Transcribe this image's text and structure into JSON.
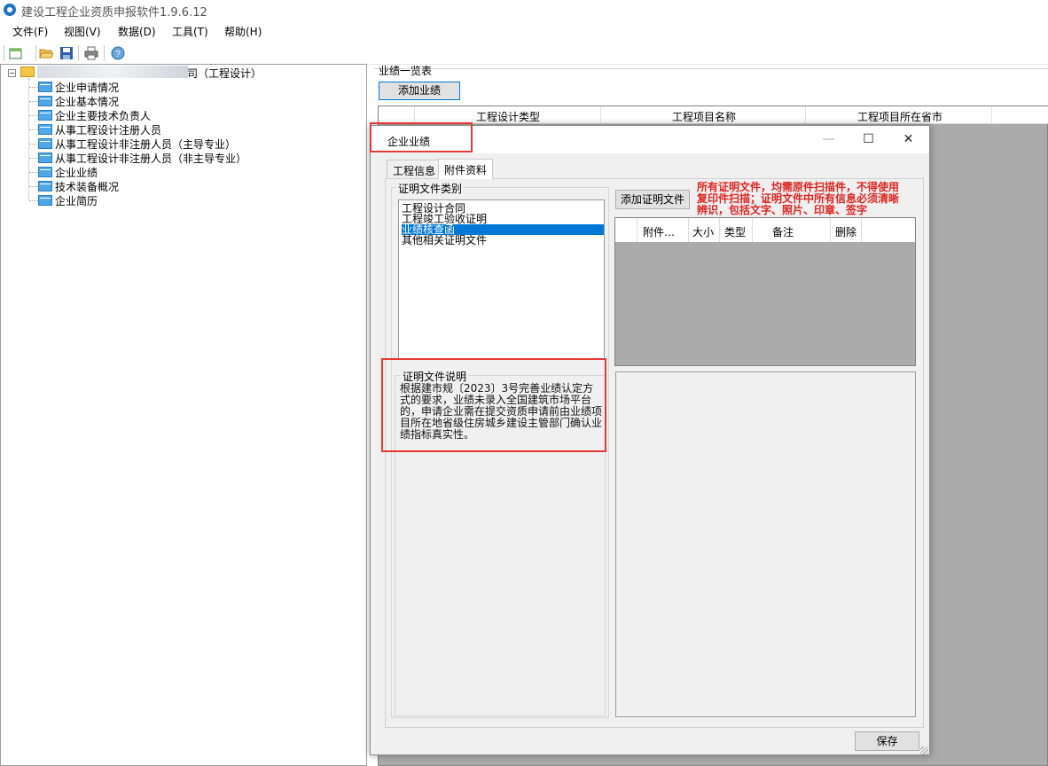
{
  "app": {
    "title": "建设工程企业资质申报软件1.9.6.12"
  },
  "menu": [
    "文件(F)",
    "视图(V)",
    "数据(D)",
    "工具(T)",
    "帮助(H)"
  ],
  "toolbar": {
    "icons": [
      "new-icon",
      "open-folder-icon",
      "save-icon",
      "print-icon",
      "help-icon"
    ]
  },
  "tree": {
    "root_label": "司（工程设计）",
    "items": [
      "企业申请情况",
      "企业基本情况",
      "企业主要技术负责人",
      "从事工程设计注册人员",
      "从事工程设计非注册人员（主导专业）",
      "从事工程设计非注册人员（非主导专业）",
      "企业业绩",
      "技术装备概况",
      "企业简历"
    ]
  },
  "main": {
    "group_label": "业绩一览表",
    "add_button": "添加业绩",
    "columns": [
      "工程设计类型",
      "工程项目名称",
      "工程项目所在省市"
    ]
  },
  "dialog": {
    "title": "企业业绩",
    "window_buttons": {
      "minimize": "—",
      "maximize": "☐",
      "close": "✕"
    },
    "tabs": [
      "工程信息",
      "附件资料"
    ],
    "active_tab": "附件资料",
    "category_group_label": "证明文件类别",
    "categories": [
      "工程设计合同",
      "工程竣工验收证明",
      "业绩核查函",
      "其他相关证明文件"
    ],
    "selected_category": "业绩核查函",
    "description_label": "证明文件说明",
    "description_text": "根据建市规〔2023〕3号完善业绩认定方式的要求，业绩未录入全国建筑市场平台的，申请企业需在提交资质申请前由业绩项目所在地省级住房城乡建设主管部门确认业绩指标真实性。",
    "add_file_button": "添加证明文件",
    "warning_text": "所有证明文件，均需原件扫描件，不得使用复印件扫描；证明文件中所有信息必须清晰辨识，包括文字、照片、印章、签字",
    "file_columns": [
      "附件…",
      "大小",
      "类型",
      "备注",
      "删除"
    ],
    "save_button": "保存"
  },
  "colors": {
    "selection": "#0078d7",
    "highlight_box": "#e53935",
    "warning_text": "#e0231d",
    "grid_background": "#ababab"
  }
}
